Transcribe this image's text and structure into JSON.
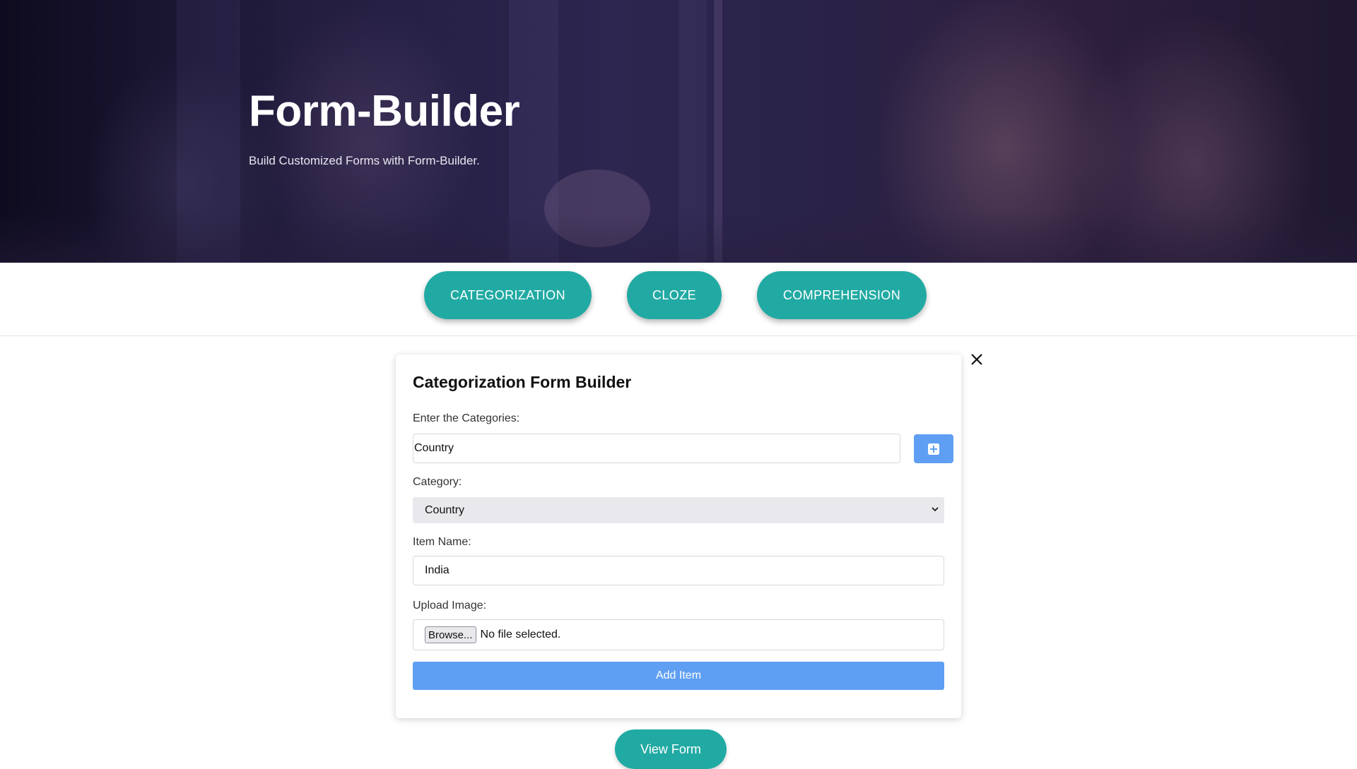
{
  "hero": {
    "title": "Form-Builder",
    "subtitle": "Build Customized Forms with Form-Builder."
  },
  "tabs": [
    {
      "label": "CATEGORIZATION"
    },
    {
      "label": "CLOZE"
    },
    {
      "label": "COMPREHENSION"
    }
  ],
  "form": {
    "title": "Categorization Form Builder",
    "categories_label": "Enter the Categories:",
    "categories_value": "Country",
    "add_category_icon": "plus-square-icon",
    "category_label": "Category:",
    "category_selected": "Country",
    "item_name_label": "Item Name:",
    "item_name_value": "India",
    "upload_label": "Upload Image:",
    "browse_label": "Browse...",
    "file_status": "No file selected.",
    "add_item_label": "Add Item",
    "close_icon": "close-icon"
  },
  "view_form_label": "View Form",
  "colors": {
    "teal": "#21aaa3",
    "blue": "#5f9ff3",
    "select_bg": "#e9e9ed"
  }
}
